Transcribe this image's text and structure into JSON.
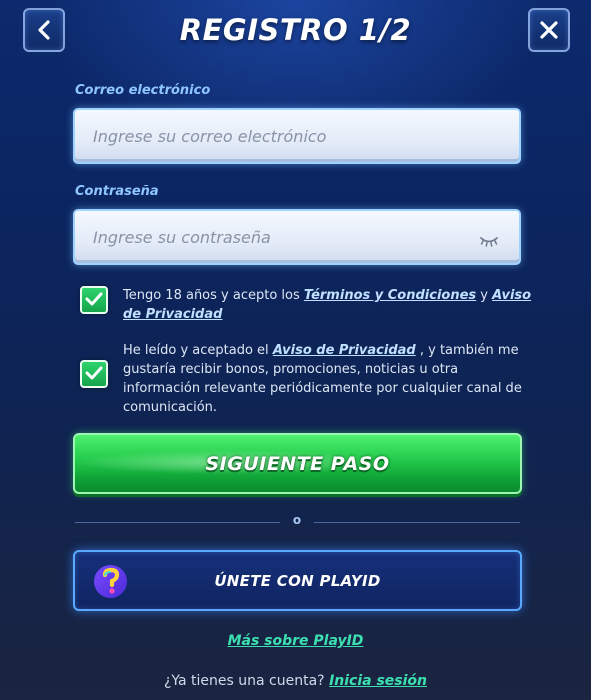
{
  "header": {
    "title": "REGISTRO 1/2",
    "back_icon": "chevron-left-icon",
    "close_icon": "close-icon"
  },
  "email": {
    "label": "Correo electrónico",
    "placeholder": "Ingrese su correo electrónico",
    "value": ""
  },
  "password": {
    "label": "Contraseña",
    "placeholder": "Ingrese su contraseña",
    "value": "",
    "toggle_icon": "eye-closed-icon"
  },
  "consents": [
    {
      "checked": true,
      "text_before": "Tengo 18 años y acepto los ",
      "link1": "Términos y Condiciones",
      "text_middle": " y ",
      "link2": "Aviso de Privacidad"
    },
    {
      "checked": true,
      "text_before": "He leído y aceptado el ",
      "link1": "Aviso de Privacidad",
      "text_after": " , y también me gustaría recibir bonos, promociones, noticias u otra información relevante periódicamente por cualquier canal de comunicación."
    }
  ],
  "next_button": {
    "label": "SIGUIENTE PASO"
  },
  "divider": {
    "label": "o"
  },
  "playid": {
    "label": "ÚNETE CON PLAYID",
    "logo_icon": "playid-logo-icon",
    "more_link": "Más sobre PlayID"
  },
  "footer": {
    "question": "¿Ya tienes una cuenta? ",
    "login_link": "Inicia sesión"
  },
  "colors": {
    "background": "#0d2a6e",
    "accent_label": "#8fc6ff",
    "primary_green": "#22c94a",
    "link_teal": "#3ce0b0",
    "playid_border": "#5aa9ff"
  }
}
